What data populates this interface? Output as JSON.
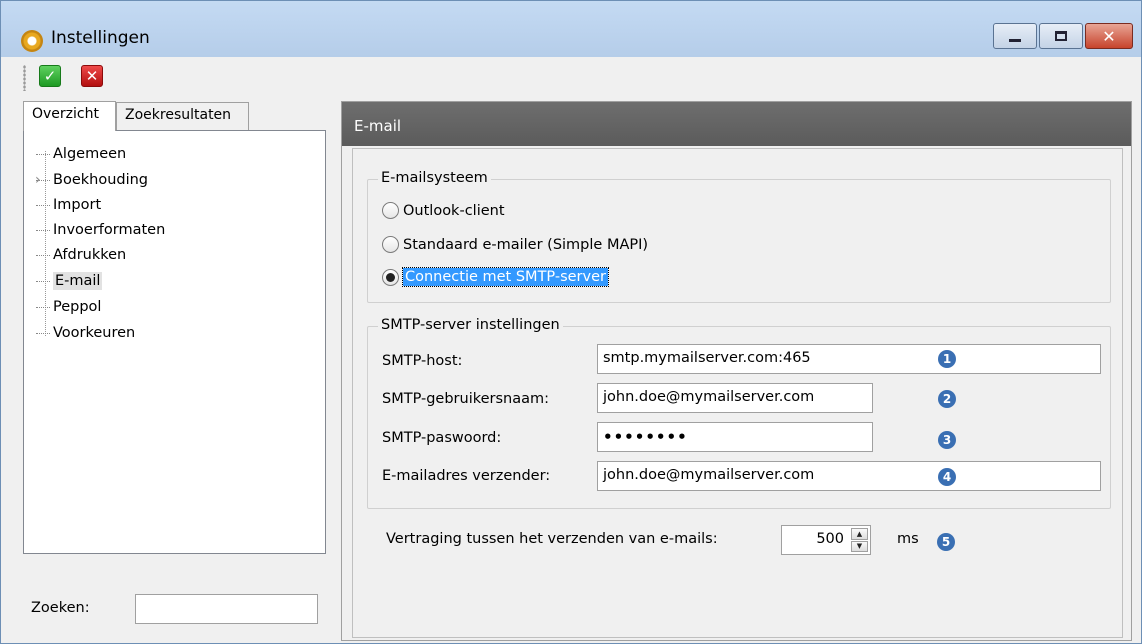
{
  "window": {
    "title": "Instellingen",
    "controls": {
      "minimize": "—",
      "maximize": "□",
      "close": "✕"
    }
  },
  "toolbar": {
    "ok_icon": "check-icon",
    "cancel_icon": "close-icon"
  },
  "tabs": [
    {
      "label": "Overzicht",
      "active": true
    },
    {
      "label": "Zoekresultaten",
      "active": false
    }
  ],
  "tree": {
    "items": [
      {
        "label": "Algemeen"
      },
      {
        "label": "Boekhouding",
        "expandable": true
      },
      {
        "label": "Import"
      },
      {
        "label": "Invoerformaten"
      },
      {
        "label": "Afdrukken"
      },
      {
        "label": "E-mail",
        "selected": true
      },
      {
        "label": "Peppol"
      },
      {
        "label": "Voorkeuren"
      }
    ]
  },
  "search": {
    "label": "Zoeken:",
    "value": ""
  },
  "section": {
    "title": "E-mail"
  },
  "email_system": {
    "legend": "E-mailsysteem",
    "options": [
      {
        "label": "Outlook-client",
        "checked": false
      },
      {
        "label": "Standaard e-mailer (Simple MAPI)",
        "checked": false
      },
      {
        "label": "Connectie met SMTP-server",
        "checked": true
      }
    ]
  },
  "smtp": {
    "legend": "SMTP-server instellingen",
    "host": {
      "label": "SMTP-host:",
      "value": "smtp.mymailserver.com:465",
      "badge": "1"
    },
    "username": {
      "label": "SMTP-gebruikersnaam:",
      "value": "john.doe@mymailserver.com",
      "badge": "2"
    },
    "password": {
      "label": "SMTP-paswoord:",
      "value": "••••••••",
      "badge": "3"
    },
    "sender": {
      "label": "E-mailadres verzender:",
      "value": "john.doe@mymailserver.com",
      "badge": "4"
    }
  },
  "delay": {
    "label": "Vertraging tussen het verzenden van e-mails:",
    "value": "500",
    "unit": "ms",
    "badge": "5"
  },
  "colors": {
    "header_bg": "#5f5f5f",
    "selection": "#3399ff",
    "badge": "#3a6fb3"
  }
}
